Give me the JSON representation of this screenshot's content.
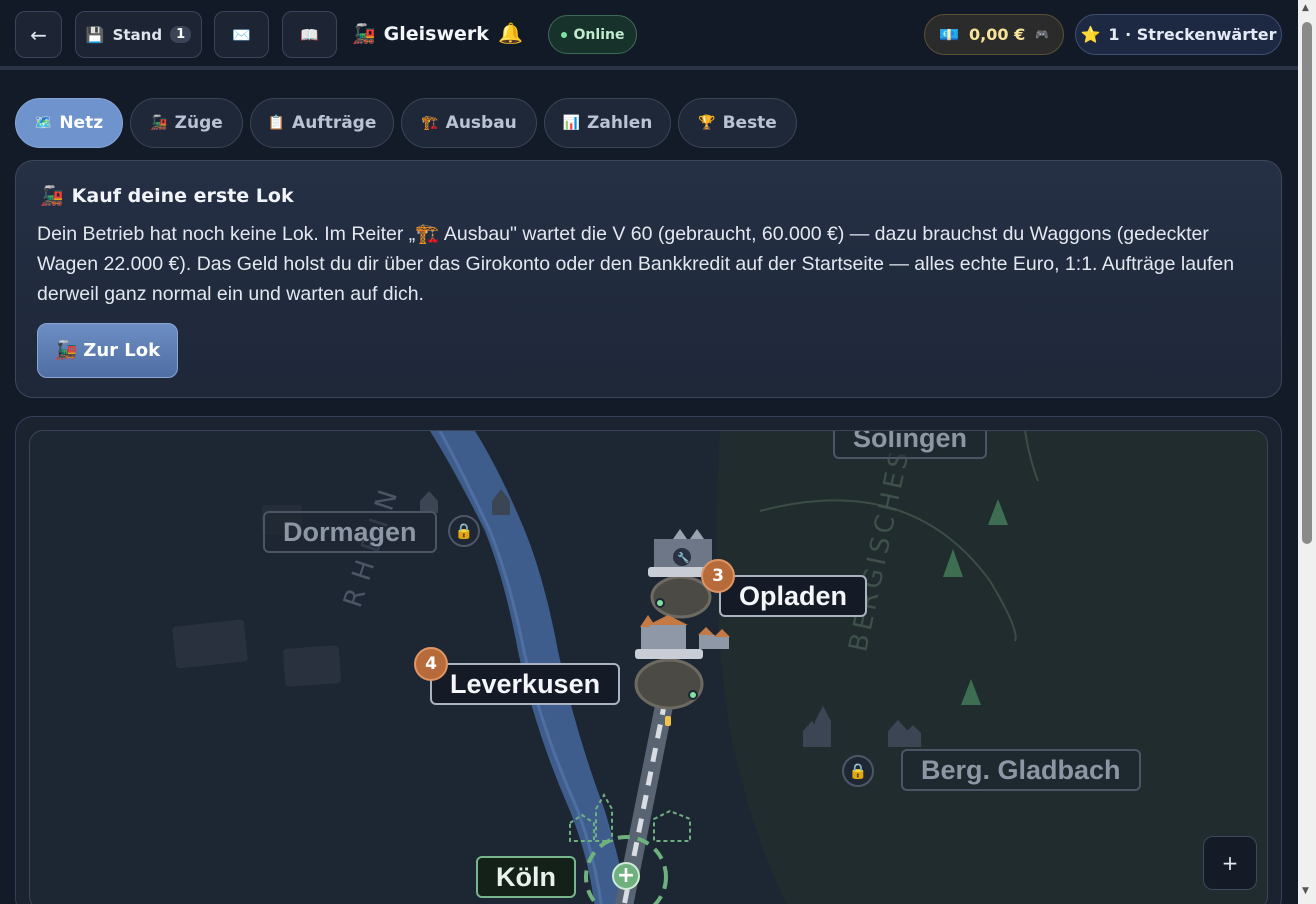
{
  "header": {
    "back_icon": "←",
    "save_icon": "💾",
    "stand_label": "Stand",
    "stand_count": "1",
    "mail_icon": "✉️",
    "book_icon": "📖",
    "app_icon": "🚂",
    "app_title": "Gleiswerk",
    "bell_icon": "🔔",
    "status_label": "Online",
    "money_icon": "💶",
    "money_value": "0,00 €",
    "money_extra_icon": "🎮",
    "rank_icon": "⭐",
    "rank_label": "1 · Streckenwärter"
  },
  "tabs": [
    {
      "icon": "🗺️",
      "label": "Netz",
      "active": true
    },
    {
      "icon": "🚂",
      "label": "Züge",
      "active": false
    },
    {
      "icon": "📋",
      "label": "Aufträge",
      "active": false
    },
    {
      "icon": "🏗️",
      "label": "Ausbau",
      "active": false
    },
    {
      "icon": "📊",
      "label": "Zahlen",
      "active": false
    },
    {
      "icon": "🏆",
      "label": "Beste",
      "active": false
    }
  ],
  "info": {
    "title_icon": "🚂",
    "title": "Kauf deine erste Lok",
    "body": "Dein Betrieb hat noch keine Lok. Im Reiter „🏗️ Ausbau\" wartet die V 60 (gebraucht, 60.000 €) — dazu brauchst du Waggons (gedeckter Wagen 22.000 €). Das Geld holst du dir über das Girokonto oder den Bankkredit auf der Startseite — alles echte Euro, 1:1. Aufträge laufen derweil ganz normal ein und warten auf dich.",
    "cta_icon": "🚂",
    "cta_label": "Zur Lok"
  },
  "map": {
    "region_labels": {
      "river": "RHEIN",
      "hills": "BERGISCHES"
    },
    "stations": [
      {
        "name": "Solingen",
        "state": "locked"
      },
      {
        "name": "Dormagen",
        "state": "locked"
      },
      {
        "name": "Opladen",
        "state": "active",
        "badge": "3"
      },
      {
        "name": "Leverkusen",
        "state": "active",
        "badge": "4"
      },
      {
        "name": "Berg. Gladbach",
        "state": "locked"
      },
      {
        "name": "Köln",
        "state": "home"
      }
    ],
    "lock_icon": "🔒",
    "add_icon": "+",
    "zoom_in_label": "+"
  },
  "colors": {
    "accent": "#6f93cc",
    "home": "#78b58d",
    "badge": "#b86b3a",
    "river": "#3f5d8c"
  }
}
